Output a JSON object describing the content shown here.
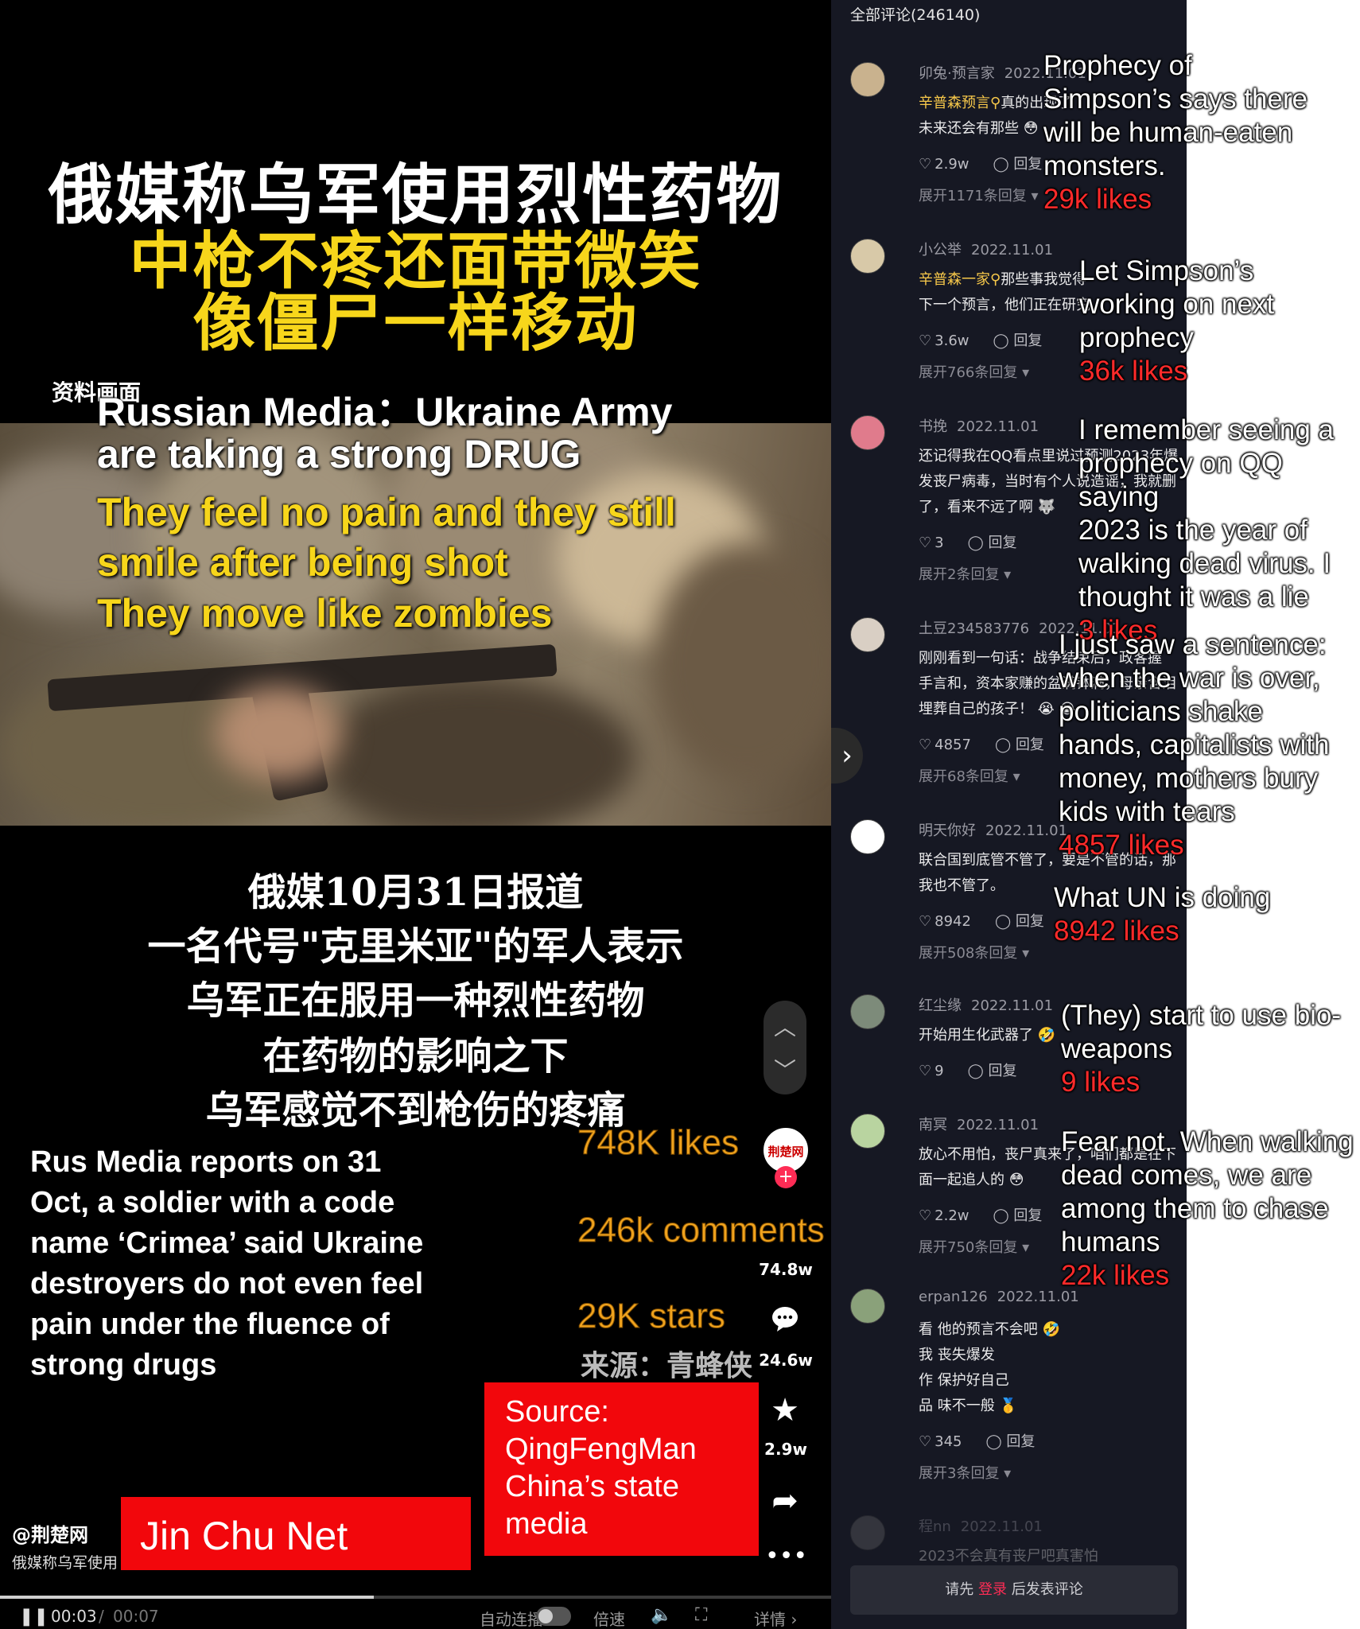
{
  "video": {
    "title_lines": [
      "俄媒称乌军使用烈性药物",
      "中枪不疼还面带微笑",
      "像僵尸一样移动"
    ],
    "source_tag": "资料画面",
    "subtitles_white": [
      "Russian Media：Ukraine Army",
      "are taking a strong DRUG"
    ],
    "subtitles_yellow": [
      "They feel no pain and they still",
      "smile after being shot",
      "They move like zombies"
    ],
    "body_lines": [
      "俄媒10月31日报道",
      "一名代号\"克里米亚\"的军人表示",
      "乌军正在服用一种烈性药物",
      "在药物的影响之下",
      "乌军感觉不到枪伤的疼痛"
    ],
    "english_summary": "Rus Media reports on 31 Oct, a soldier with a code name ‘Crimea’ said Ukraine destroyers do not even feel pain under the fluence of strong drugs",
    "notes": {
      "likes": "748K likes",
      "comments": "246k comments",
      "stars": "29K stars"
    },
    "laiyuan": "来源：青蜂侠",
    "source_box": "Source:\nQingFengMan\nChina’s state\nmedia",
    "jinchu_box": "Jin Chu Net",
    "handle": "@荆楚网",
    "desc": "俄媒称乌军使用",
    "avatar_text": "荆楚网",
    "rail": {
      "like_count": "74.8w",
      "comment_count": "24.6w",
      "star_count": "2.9w"
    },
    "player": {
      "progress": 0.45,
      "time_current": "00:03",
      "time_sep": "/",
      "time_total": "00:07",
      "autoplay": "自动连播",
      "speed": "倍速",
      "detail": "详情 ›"
    }
  },
  "comments": {
    "header": "全部评论(246140)",
    "items": [
      {
        "name": "卯兔·预言家",
        "date": "2022.11.01",
        "tag": "辛普森预言",
        "text": "真的出现了\n未来还会有那些 😳",
        "likes": "2.9w",
        "reply": "回复",
        "expand": "展开1171条回复 ▾",
        "avatar_color": "#c9b28e"
      },
      {
        "name": "小公举",
        "date": "2022.11.01",
        "tag": "辛普森一家",
        "text": "那些事我觉得\n下一个预言，他们正在研究",
        "likes": "3.6w",
        "reply": "回复",
        "expand": "展开766条回复 ▾",
        "avatar_color": "#d8c9a8"
      },
      {
        "name": "书挽",
        "date": "2022.11.01",
        "tag": "",
        "text": "还记得我在QQ看点里说过预测2023年爆\n发丧尸病毒，当时有个人说造谣，我就删\n了，看来不远了啊 🐺",
        "likes": "3",
        "reply": "回复",
        "expand": "展开2条回复 ▾",
        "avatar_color": "#e07b8c"
      },
      {
        "name": "土豆234583776",
        "date": "2022.11.01",
        "tag": "",
        "text": "刚刚看到一句话：战争结束后，政客握\n手言和，资本家赚的盆满钵满，母亲含泪\n埋葬自己的孩子！ 😭 😭",
        "likes": "4857",
        "reply": "回复",
        "expand": "展开68条回复 ▾",
        "avatar_color": "#d9cfc4"
      },
      {
        "name": "明天你好",
        "date": "2022.11.01",
        "tag": "",
        "text": "联合国到底管不管了，要是不管的话，那\n我也不管了。",
        "likes": "8942",
        "reply": "回复",
        "expand": "展开508条回复 ▾",
        "avatar_color": "#ffffff"
      },
      {
        "name": "红尘缘",
        "date": "2022.11.01",
        "tag": "",
        "text": "开始用生化武器了 🤣",
        "likes": "9",
        "reply": "回复",
        "expand": "",
        "avatar_color": "#7d8b7a"
      },
      {
        "name": "南冥",
        "date": "2022.11.01",
        "tag": "",
        "text": "放心不用怕，丧尸真来了，咱们都是在下\n面一起追人的 😳",
        "likes": "2.2w",
        "reply": "回复",
        "expand": "展开750条回复 ▾",
        "avatar_color": "#b9d4a0"
      },
      {
        "name": "erpan126",
        "date": "2022.11.01",
        "tag": "",
        "text": "看 他的预言不会吧 🤣\n我 丧失爆发\n作 保护好自己\n品 味不一般 🥇",
        "likes": "345",
        "reply": "回复",
        "expand": "展开3条回复 ▾",
        "avatar_color": "#8aa17a"
      },
      {
        "name": "程nn",
        "date": "2022.11.01",
        "tag": "",
        "text": "2023不会真有丧尸吧真害怕",
        "likes": "",
        "reply": "",
        "expand": "",
        "avatar_color": "#6d6d6d"
      }
    ],
    "login": {
      "prefix": "请先",
      "link": "登录",
      "suffix": "后发表评论"
    }
  },
  "translations": [
    {
      "text": "Prophecy of\nSimpson’s says there\nwill be human-eaten\nmonsters.",
      "likes": "29k likes"
    },
    {
      "text": "Let Simpson’s\nworking on next\nprophecy",
      "likes": "36k likes"
    },
    {
      "text": "I remember seeing a\nprophecy on QQ saying\n2023 is the year of\nwalking dead virus. I\nthought it was a lie",
      "likes": "3 likes"
    },
    {
      "text": "I just saw a sentence:\nwhen the war is over,\npoliticians shake\nhands, capitalists with\nmoney, mothers bury\nkids with tears",
      "likes": "4857 likes"
    },
    {
      "text": "What UN is doing",
      "likes": "8942 likes"
    },
    {
      "text": "(They) start to use bio-\nweapons",
      "likes": "9 likes"
    },
    {
      "text": "Fear not. When walking\ndead comes, we are\namong them to chase\nhumans",
      "likes": "22k likes"
    }
  ],
  "icons": {
    "nav_up": "chevron-up",
    "nav_down": "chevron-down",
    "comment": "comment-bubble",
    "star": "star",
    "share": "share-arrow",
    "more": "more-dots",
    "pause": "pause",
    "volume": "volume",
    "fullscreen": "fullscreen",
    "panel_chevron": "chevron-right"
  },
  "colors": {
    "title_yellow": "#f7d61b",
    "red_box": "#f2070c",
    "like_red": "#ff2a2a",
    "note_orange": "#f0a31e",
    "comments_bg": "#161823",
    "login_link": "#fe2c55"
  }
}
